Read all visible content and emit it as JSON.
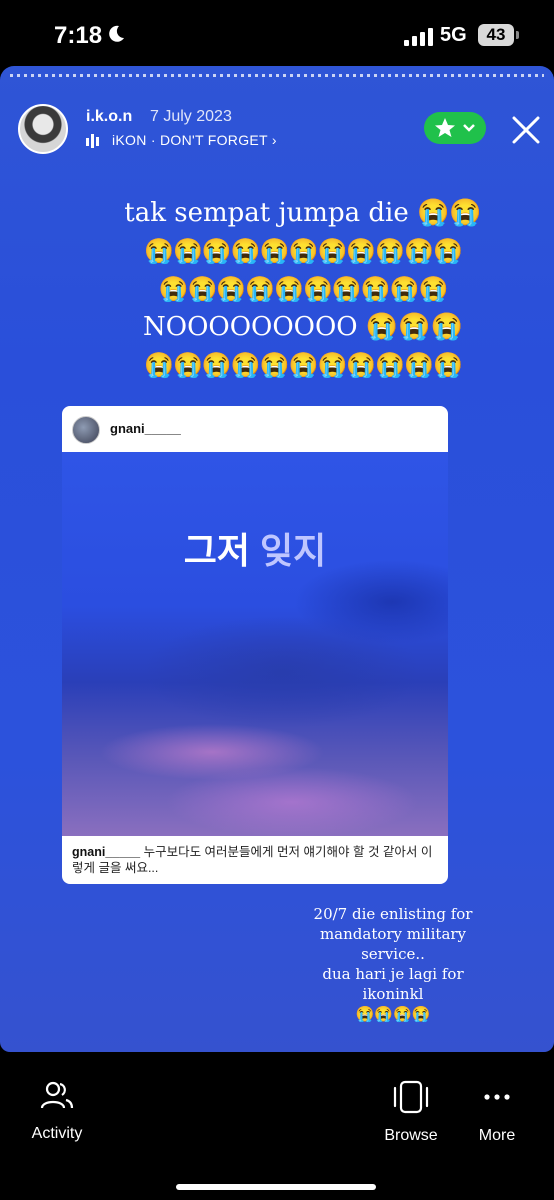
{
  "status_bar": {
    "time": "7:18",
    "network": "5G",
    "battery": "43"
  },
  "story": {
    "username": "i.k.o.n",
    "date": "7 July 2023",
    "music": "iKON · DON'T FORGET",
    "caption_lines": [
      "tak sempat jumpa die 😭😭",
      "😭😭😭😭😭😭😭😭😭😭😭",
      "😭😭😭😭😭😭😭😭😭😭",
      "NOOOOOOOOO 😭😭😭",
      "😭😭😭😭😭😭😭😭😭😭😭"
    ],
    "shared_post": {
      "username": "gnani_____",
      "title_a": "그저",
      "title_b": "잊지",
      "caption_user": "gnani_____",
      "caption_text": "누구보다도 여러분들에게 먼저 얘기해야 할 것 같아서 이렇게 글을 써요..."
    },
    "bottom_caption": [
      "20/7 die enlisting for",
      "mandatory military service..",
      "dua hari je lagi for ikoninkl",
      "😭😭😭😭"
    ]
  },
  "bottom_nav": {
    "activity": "Activity",
    "browse": "Browse",
    "more": "More"
  },
  "colors": {
    "story_bg": "#2c52dc",
    "badge_green": "#20c14b"
  }
}
